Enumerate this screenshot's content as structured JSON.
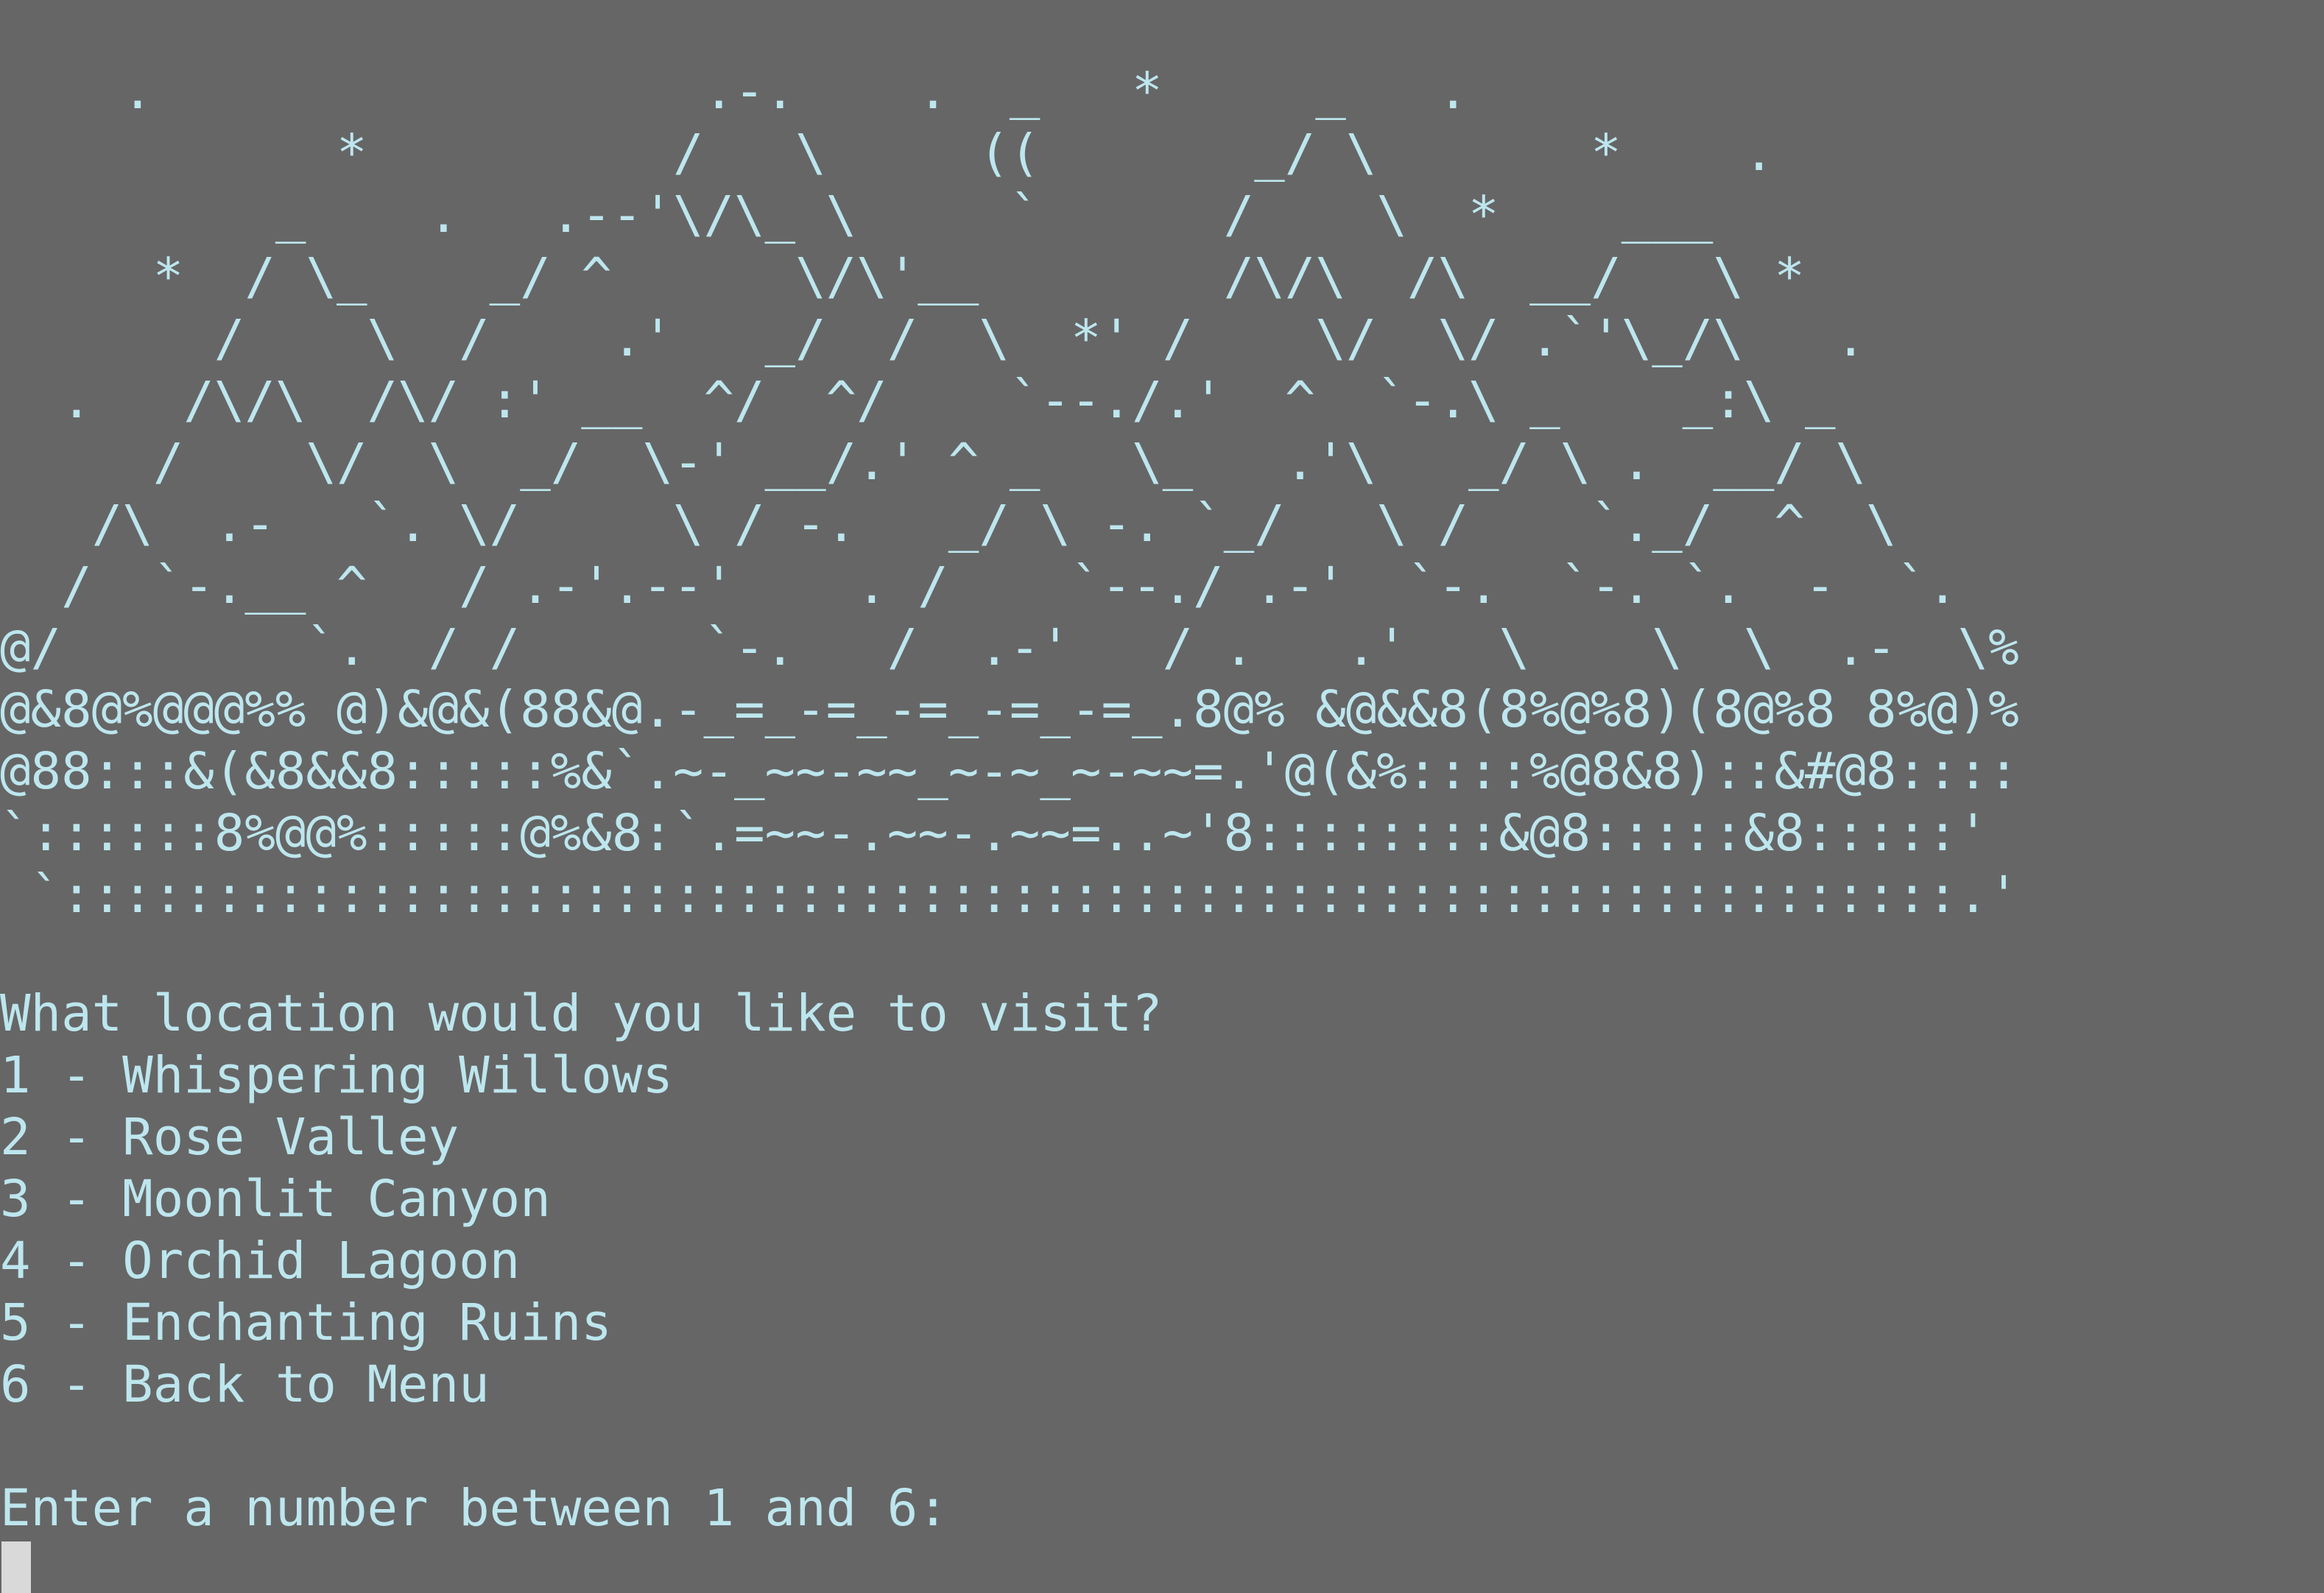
{
  "theme": {
    "background": "#666666",
    "foreground": "#bde6ee",
    "cursor": "#d9d9d9"
  },
  "art": [
    "    .                  .-.    .  _   *     _   .",
    "           *          /   \\     ((       _/ \\       *    .",
    "         _    .   .--'\\/\\_ \\     `      /    \\  *    ___",
    "     *  / \\_    _/ ^      \\/\\'__        /\\/\\  /\\  __/   \\ *",
    "       /    \\  /    .'   _/  /  \\  *' /    \\/  \\/ .`'\\_/\\   .",
    "  .   /\\/\\  /\\/ :' __  ^/  ^/    `--./.'  ^  `-.\\ _    _:\\ _",
    "     /    \\/  \\  _/  \\-' __/.' ^ _   \\_   .'\\   _/ \\ .  __/ \\",
    "   /\\  .-   `. \\/     \\ / -.   _/ \\ -. `_/   \\ /    `._/  ^  \\",
    "  /  `-.__ ^   / .-'.--'    . /    `--./ .-'  `-.  `-. `.  -  `.",
    "@/        `.  / /      `-.   /  .-'   / .   .'   \\    \\  \\  .-  \\%",
    "@&8@%@@@%% @)&@&(88&@.-_=_-=_-=_-=_-=_.8@% &@&&8(8%@%8)(8@%8 8%@)%",
    "@88:::&(&8&&8:::::%&`.~-_~~-~~_~-~_~-~~=.'@(&%::::%@8&8)::&#@8::::",
    "`::::::8%@@%:::::@%&8:`.=~~-.~~-.~~=..~'8::::::::&@8:::::&8:::::'",
    " `::::::::::::::::::::::::::::::::::::::::::::::::::::::::::::::.'"
  ],
  "prompt": {
    "question": "What location would you like to visit?",
    "options": [
      "1 - Whispering Willows",
      "2 - Rose Valley",
      "3 - Moonlit Canyon",
      "4 - Orchid Lagoon",
      "5 - Enchanting Ruins",
      "6 - Back to Menu"
    ],
    "input_prompt": "Enter a number between 1 and 6:"
  }
}
